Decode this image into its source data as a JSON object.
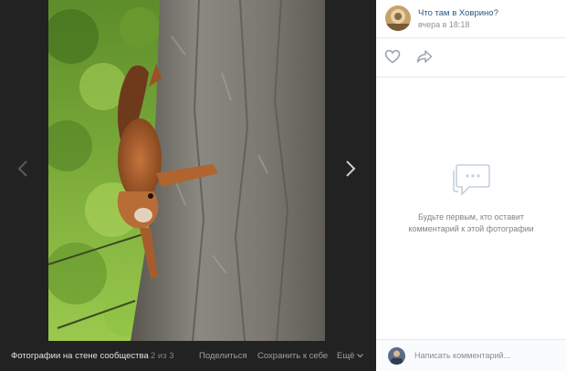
{
  "viewer": {
    "prev_icon": "chevron-left-icon",
    "next_icon": "chevron-right-icon",
    "photo_subject": "squirrel on tree trunk",
    "bottom": {
      "album_label": "Фотографии на стене сообщества",
      "counter": "2 из 3",
      "share_label": "Поделиться",
      "save_label": "Сохранить к себе",
      "more_label": "Ещё"
    }
  },
  "panel": {
    "group_name": "Что там в Ховрино?",
    "post_time": "вчера в 18:18",
    "like_icon": "heart-icon",
    "share_icon": "share-arrow-icon",
    "empty_state": {
      "icon": "comments-icon",
      "text": "Будьте первым, кто оставит комментарий к этой фотографии"
    },
    "composer": {
      "placeholder": "Написать комментарий..."
    }
  },
  "colors": {
    "link": "#2a5885",
    "muted": "#939393",
    "viewer_bg": "#222222"
  }
}
